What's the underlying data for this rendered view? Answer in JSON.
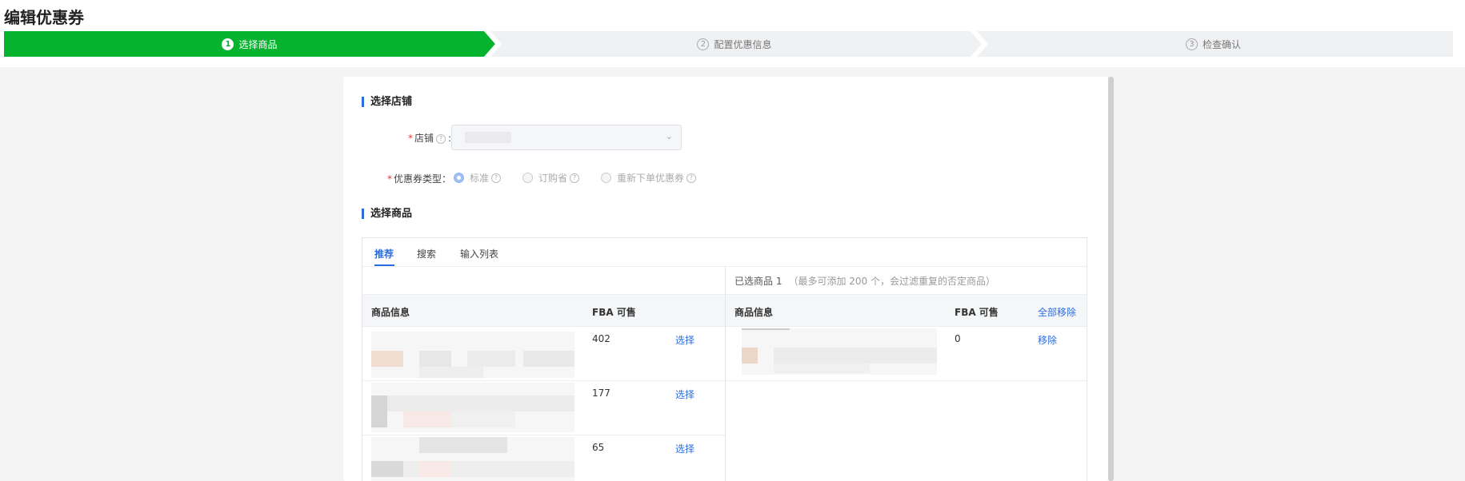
{
  "page": {
    "title": "编辑优惠券"
  },
  "steps": [
    {
      "num": "1",
      "label": "选择商品",
      "state": "active"
    },
    {
      "num": "2",
      "label": "配置优惠信息",
      "state": "pending"
    },
    {
      "num": "3",
      "label": "检查确认",
      "state": "pending"
    }
  ],
  "colors": {
    "step_active": "#06b32f",
    "accent": "#2d6cdf",
    "required": "#e53935"
  },
  "store_section": {
    "title": "选择店铺",
    "store_label": "店铺",
    "store_value": "",
    "coupon_type_label": "优惠券类型：",
    "coupon_types": [
      {
        "label": "标准",
        "checked": true
      },
      {
        "label": "订购省",
        "checked": false
      },
      {
        "label": "重新下单优惠券",
        "checked": false
      }
    ]
  },
  "product_section": {
    "title": "选择商品",
    "tabs": [
      "推荐",
      "搜索",
      "输入列表"
    ],
    "active_tab": "推荐",
    "left": {
      "col_info": "商品信息",
      "col_fba": "FBA 可售",
      "rows": [
        {
          "fba": "402",
          "action": "选择"
        },
        {
          "fba": "177",
          "action": "选择"
        },
        {
          "fba": "65",
          "action": "选择"
        }
      ]
    },
    "right": {
      "selected_label": "已选商品 1",
      "selected_hint": "（最多可添加 200 个，会过滤重复的否定商品）",
      "col_info": "商品信息",
      "col_fba": "FBA 可售",
      "remove_all": "全部移除",
      "rows": [
        {
          "fba": "0",
          "action": "移除"
        }
      ]
    }
  }
}
